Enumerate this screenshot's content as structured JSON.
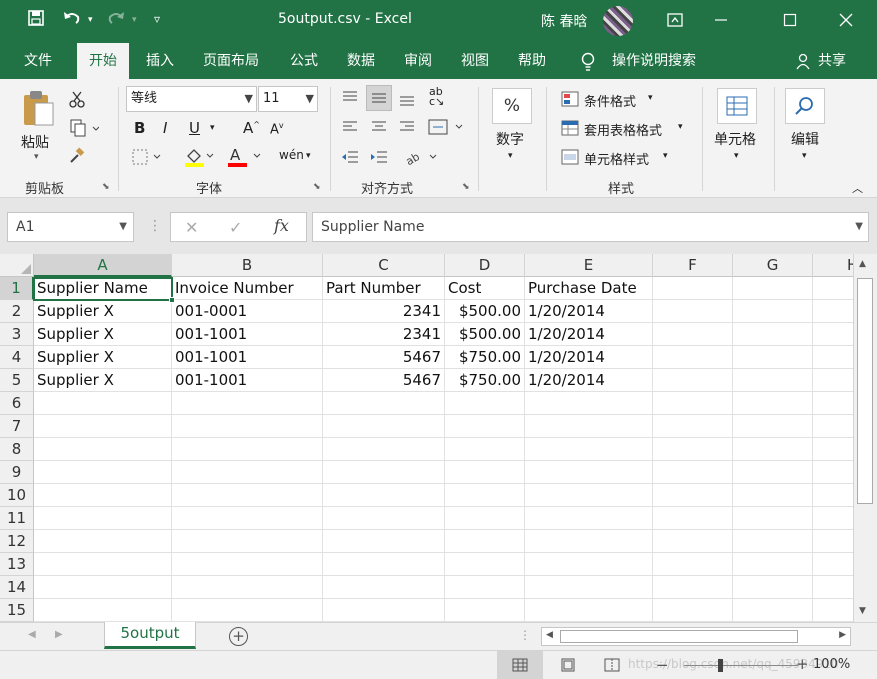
{
  "window": {
    "title": "5output.csv  -  Excel",
    "user": "陈 春晗"
  },
  "menu": {
    "tabs": [
      "文件",
      "开始",
      "插入",
      "页面布局",
      "公式",
      "数据",
      "审阅",
      "视图",
      "帮助",
      "操作说明搜索"
    ],
    "share": "共享"
  },
  "ribbon": {
    "clipboard": {
      "paste": "粘贴",
      "group": "剪贴板"
    },
    "font": {
      "name": "等线",
      "size": "11",
      "group": "字体"
    },
    "alignment": {
      "group": "对齐方式"
    },
    "number": {
      "label": "数字",
      "symbol": "%"
    },
    "styles": {
      "conditional": "条件格式",
      "table": "套用表格格式",
      "cell": "单元格样式",
      "group": "样式"
    },
    "cells": {
      "label": "单元格"
    },
    "editing": {
      "label": "编辑"
    }
  },
  "formula_bar": {
    "name_box": "A1",
    "fx": "fx",
    "content": "Supplier Name"
  },
  "grid": {
    "columns": [
      "A",
      "B",
      "C",
      "D",
      "E",
      "F",
      "G",
      "H"
    ],
    "row_numbers": [
      "1",
      "2",
      "3",
      "4",
      "5",
      "6",
      "7",
      "8",
      "9",
      "10",
      "11",
      "12",
      "13",
      "14",
      "15"
    ],
    "rows": [
      [
        "Supplier Name",
        "Invoice Number",
        "Part Number",
        "Cost",
        "Purchase Date"
      ],
      [
        "Supplier X",
        "001-0001",
        "2341",
        "$500.00",
        "1/20/2014"
      ],
      [
        "Supplier X",
        "001-1001",
        "2341",
        "$500.00",
        "1/20/2014"
      ],
      [
        "Supplier X",
        "001-1001",
        "5467",
        "$750.00",
        "1/20/2014"
      ],
      [
        "Supplier X",
        "001-1001",
        "5467",
        "$750.00",
        "1/20/2014"
      ]
    ],
    "selected": "A1"
  },
  "sheet": {
    "tab": "5output"
  },
  "status": {
    "zoom": "100%",
    "watermark": "https://blog.csdn.net/qq_45934910"
  },
  "colors": {
    "brand": "#217346",
    "ribbon_bg": "#f3f3f3"
  }
}
